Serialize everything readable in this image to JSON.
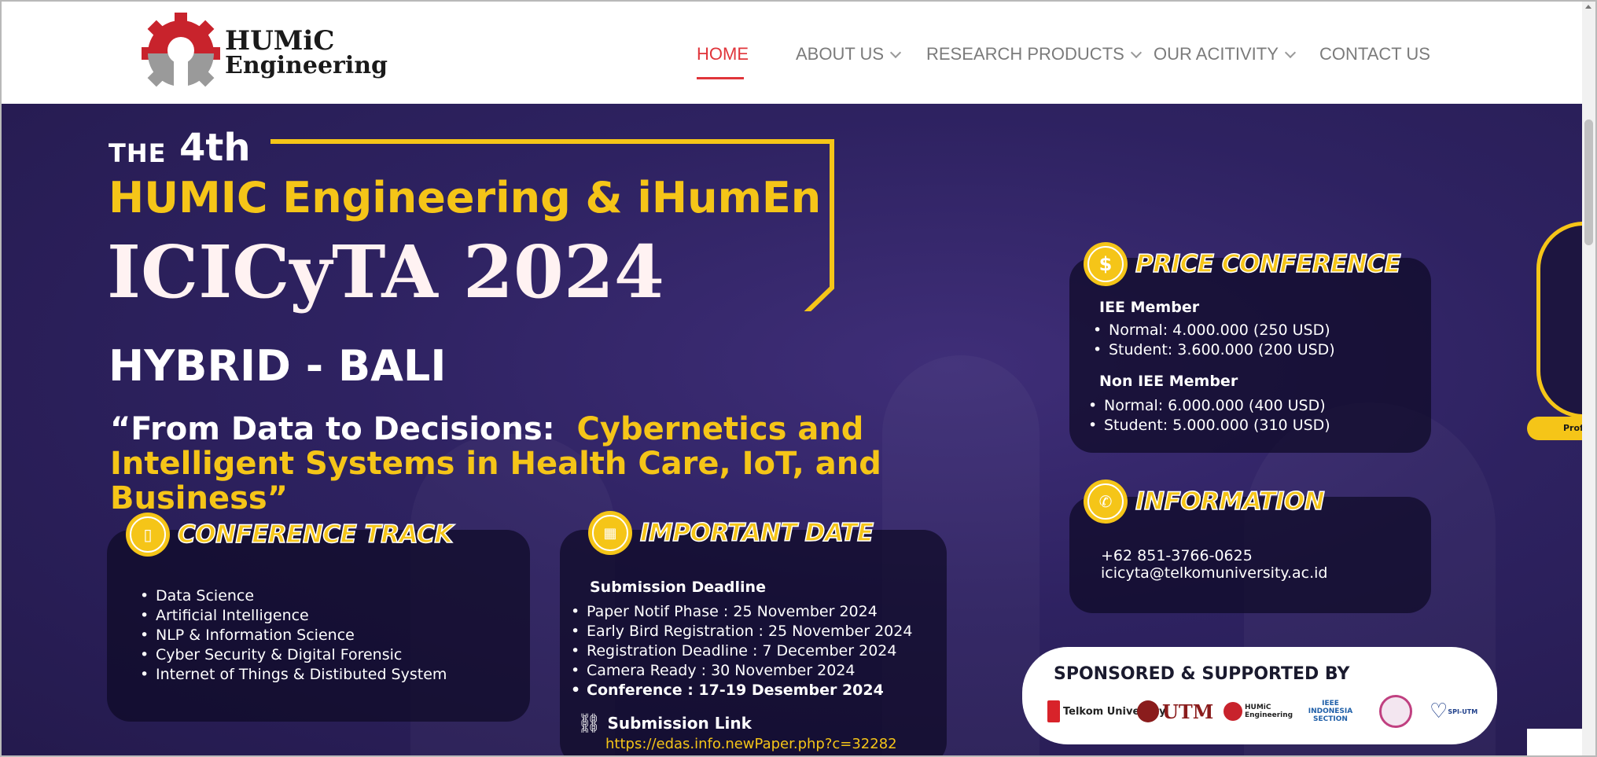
{
  "header": {
    "logo": {
      "line1": "HUMiC",
      "line2": "Engineering"
    },
    "nav": [
      {
        "label": "HOME",
        "active": true,
        "dropdown": false
      },
      {
        "label": "ABOUT US",
        "active": false,
        "dropdown": true
      },
      {
        "label": "RESEARCH PRODUCTS",
        "active": false,
        "dropdown": true
      },
      {
        "label": "OUR ACITIVITY",
        "active": false,
        "dropdown": true
      },
      {
        "label": "CONTACT US",
        "active": false,
        "dropdown": false
      }
    ]
  },
  "hero": {
    "the": "THE",
    "edition": "4th",
    "org": "HUMIC Engineering & iHumEn",
    "conference": "ICICyTA 2024",
    "location": "HYBRID - BALI",
    "quote_white": "“From Data to Decisions:",
    "quote_yellow": "Cybernetics and Intelligent Systems in Health Care, IoT, and Business”"
  },
  "conference_track": {
    "title": "CONFERENCE TRACK",
    "items": [
      "Data Science",
      "Artificial Intelligence",
      "NLP & Information Science",
      "Cyber Security & Digital Forensic",
      "Internet of Things & Distibuted System"
    ]
  },
  "important_date": {
    "title": "IMPORTANT DATE",
    "subtitle": "Submission Deadline",
    "items": [
      "Paper Notif Phase : 25 November 2024",
      "Early Bird Registration : 25 November 2024",
      "Registration Deadline : 7 December 2024",
      "Camera Ready : 30 November 2024",
      "Conference : 17-19 Desember 2024"
    ],
    "link_label": "Submission Link",
    "link_url": "https://edas.info.newPaper.php?c=32282"
  },
  "price": {
    "title": "PRICE CONFERENCE",
    "ieee_label": "IEE Member",
    "ieee_items": [
      "Normal: 4.000.000 (250 USD)",
      "Student: 3.600.000 (200 USD)"
    ],
    "non_ieee_label": "Non IEE Member",
    "non_ieee_items": [
      "Normal: 6.000.000 (400 USD)",
      "Student: 5.000.000 (310 USD)"
    ]
  },
  "information": {
    "title": "INFORMATION",
    "phone": "+62 851-3766-0625",
    "email": "icicyta@telkomuniversity.ac.id"
  },
  "sponsors": {
    "title": "SPONSORED & SUPPORTED BY",
    "logos": [
      "Telkom University",
      "UTM",
      "HUMiC Engineering",
      "IEEE INDONESIA SECTION",
      "seal",
      "SPI-UTM"
    ]
  },
  "speaker_pill": "Prof",
  "colors": {
    "accent": "#e0353b",
    "yellow": "#f5c518",
    "hero_bg": "#2e2261"
  }
}
